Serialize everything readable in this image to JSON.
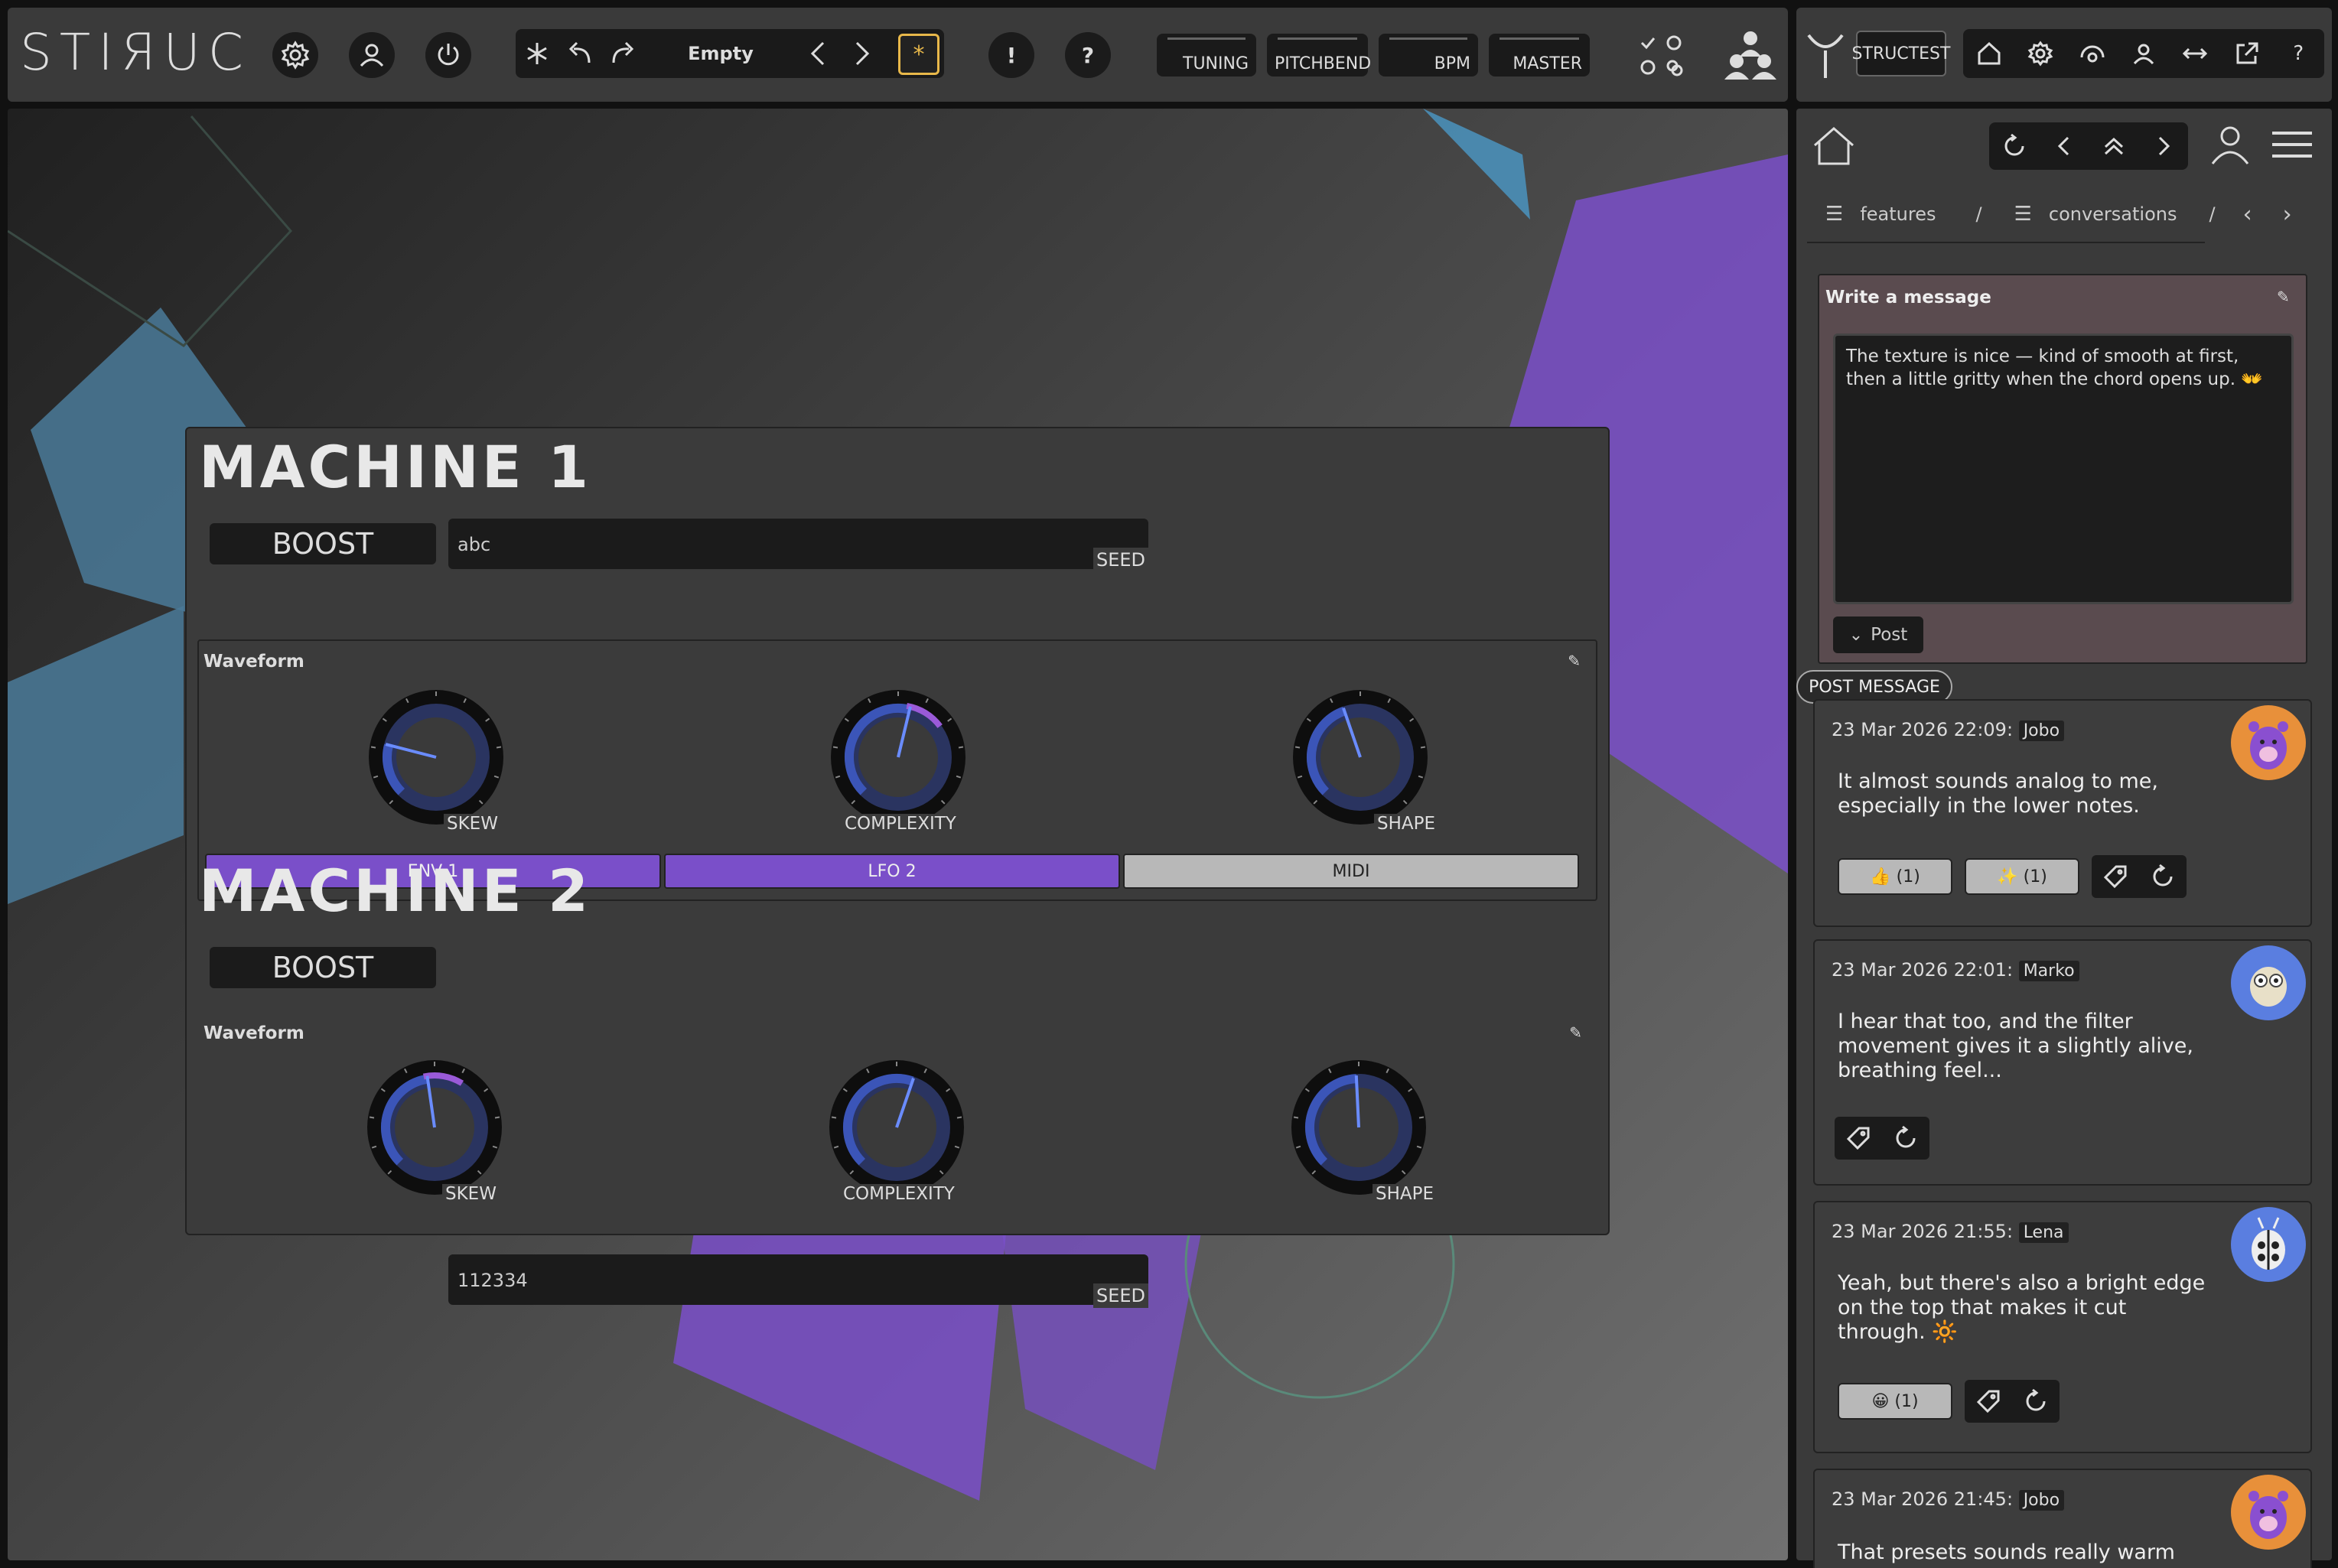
{
  "app": {
    "logo": "STIЯUC"
  },
  "transport": {
    "preset_name": "Empty",
    "star": "*"
  },
  "toolbar": {
    "alert": "!",
    "help": "?"
  },
  "meters": [
    {
      "label": "TUNING"
    },
    {
      "label": "PITCHBEND"
    },
    {
      "label": "BPM"
    },
    {
      "label": "MASTER"
    }
  ],
  "right_toolbar": {
    "structest_label": "STRUCTEST"
  },
  "breadcrumbs": {
    "item1": "features",
    "sep": "/",
    "item2": "conversations",
    "sep2": "/"
  },
  "machines": [
    {
      "title": "MACHINE 1",
      "boost_label": "BOOST",
      "seed_value": "abc",
      "seed_label": "SEED",
      "waveform_title": "Waveform",
      "knobs": [
        {
          "label": "SKEW",
          "value": 0.22
        },
        {
          "label": "COMPLEXITY",
          "value": 0.55
        },
        {
          "label": "SHAPE",
          "value": 0.43
        }
      ],
      "mod_buttons": [
        {
          "label": "ENV 1",
          "active": true
        },
        {
          "label": "LFO 2",
          "active": true
        },
        {
          "label": "MIDI",
          "active": false
        }
      ]
    },
    {
      "title": "MACHINE 2",
      "boost_label": "BOOST",
      "seed_value": "112334",
      "seed_label": "SEED",
      "waveform_title": "Waveform",
      "knobs": [
        {
          "label": "SKEW",
          "value": 0.47
        },
        {
          "label": "COMPLEXITY",
          "value": 0.57
        },
        {
          "label": "SHAPE",
          "value": 0.49
        }
      ]
    }
  ],
  "compose": {
    "title": "Write a message",
    "draft": "The texture is nice — kind of smooth at first, then a little gritty when the chord opens up. 👐",
    "post_label": "Post",
    "tooltip": "POST MESSAGE"
  },
  "messages": [
    {
      "timestamp": "23 Mar 2026 22:09:",
      "user": "Jobo",
      "text": "It almost sounds analog to me, especially in the lower notes.",
      "reactions": [
        {
          "emoji": "👍",
          "count": "(1)"
        },
        {
          "emoji": "✨",
          "count": "(1)"
        }
      ]
    },
    {
      "timestamp": "23 Mar 2026 22:01:",
      "user": "Marko",
      "text": "I hear that too, and the filter movement gives it a slightly alive, breathing feel...",
      "reactions": []
    },
    {
      "timestamp": "23 Mar 2026 21:55:",
      "user": "Lena",
      "text": "Yeah, but there's also a bright edge on the top that makes it cut through. 🔆",
      "reactions": [
        {
          "emoji": "😀",
          "count": "(1)"
        }
      ]
    },
    {
      "timestamp": "23 Mar 2026 21:45:",
      "user": "Jobo",
      "text": "That presets sounds really warm",
      "reactions": []
    }
  ],
  "colors": {
    "accent_purple": "#7a4fc9",
    "star_gold": "#e8b84a",
    "knob_blue": "#2f3f8a"
  }
}
